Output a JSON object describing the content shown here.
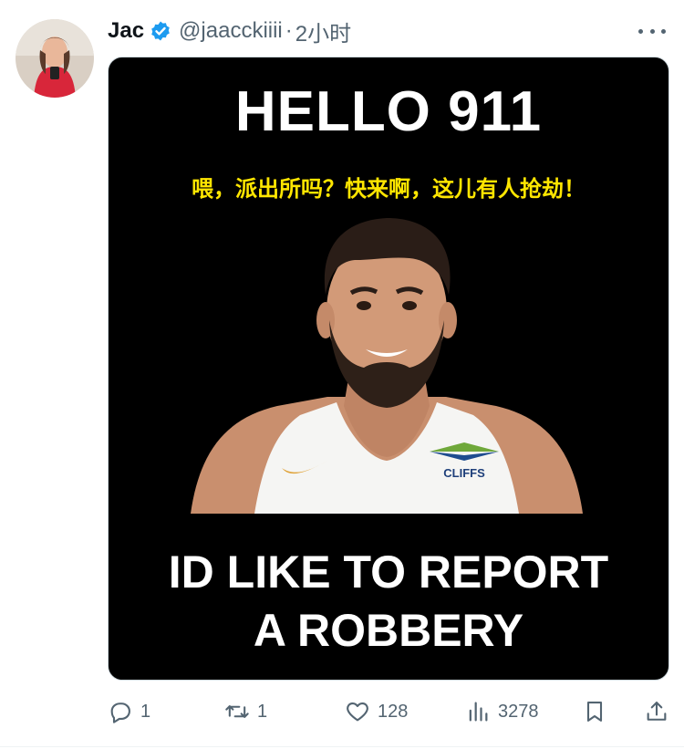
{
  "tweet": {
    "author": {
      "display_name": "Jac",
      "handle": "@jaacckiiii",
      "verified": true,
      "avatar_icon": "profile-photo"
    },
    "separator": "·",
    "time": "2小时",
    "more_icon": "ellipsis-icon"
  },
  "media": {
    "headline_top": "HELLO 911",
    "caption_cn": "喂，派出所吗？快来啊，这儿有人抢劫！",
    "jersey_sponsor": "CLIFFS",
    "headline_bottom_line1": "ID LIKE TO REPORT",
    "headline_bottom_line2": "A ROBBERY",
    "colors": {
      "background": "#000000",
      "headline": "#ffffff",
      "caption": "#ffe600"
    }
  },
  "actions": {
    "reply": {
      "icon": "reply-icon",
      "count": "1"
    },
    "retweet": {
      "icon": "retweet-icon",
      "count": "1"
    },
    "like": {
      "icon": "heart-icon",
      "count": "128"
    },
    "views": {
      "icon": "views-icon",
      "count": "3278"
    },
    "bookmark": {
      "icon": "bookmark-icon"
    },
    "share": {
      "icon": "share-icon"
    }
  },
  "colors": {
    "text": "#0f1419",
    "secondary": "#536471",
    "verified": "#1d9bf0"
  }
}
